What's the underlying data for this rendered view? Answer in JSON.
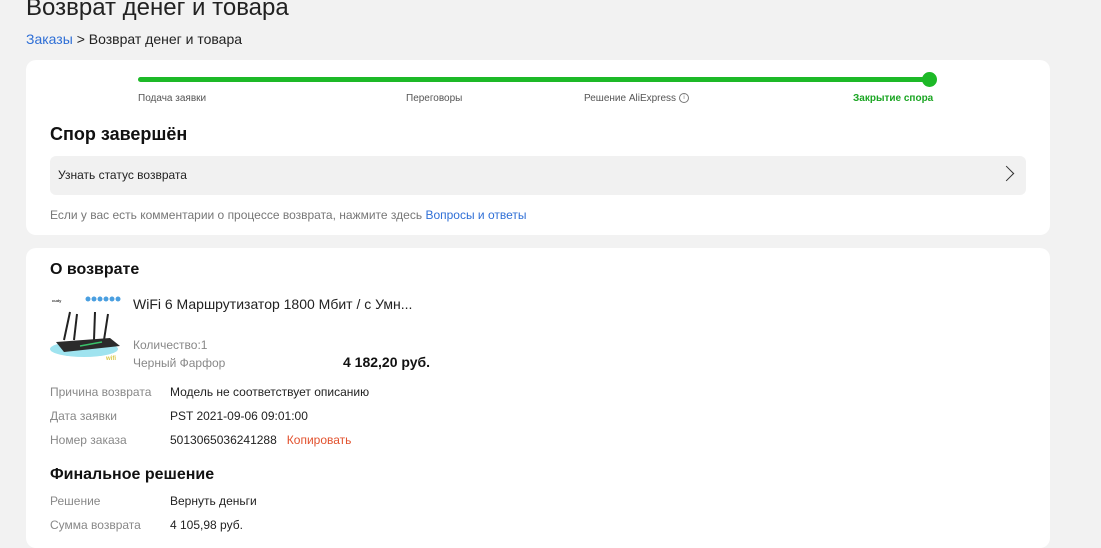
{
  "page": {
    "title": "Возврат денег и товара",
    "breadcrumb": {
      "link": "Заказы",
      "separator": ">",
      "current": "Возврат денег и товара"
    }
  },
  "progress": {
    "accent": "#1db927",
    "steps": [
      "Подача заявки",
      "Переговоры",
      "Решение AliExpress",
      "Закрытие спора"
    ],
    "active_step": "Закрытие спора",
    "complete_fraction": 1.0
  },
  "dispute": {
    "heading": "Спор завершён",
    "status_link": "Узнать статус возврата",
    "hint_text": "Если у вас есть комментарии о процессе возврата, нажмите здесь",
    "hint_link": "Вопросы и ответы"
  },
  "return_info": {
    "heading": "О возврате",
    "product": {
      "title": "WiFi 6 Маршрутизатор 1800 Мбит / с Умн...",
      "quantity": "Количество:1",
      "variant": "Черный Фарфор",
      "price": "4 182,20 руб."
    },
    "details": [
      {
        "label": "Причина возврата",
        "value": "Модель не соответствует описанию"
      },
      {
        "label": "Дата заявки",
        "value": "PST 2021-09-06 09:01:00"
      },
      {
        "label": "Номер заказа",
        "value": "5013065036241288"
      }
    ],
    "copy_label": "Копировать"
  },
  "final": {
    "heading": "Финальное решение",
    "rows": [
      {
        "label": "Решение",
        "value": "Вернуть деньги"
      },
      {
        "label": "Сумма возврата",
        "value": "4 105,98 руб."
      }
    ]
  }
}
